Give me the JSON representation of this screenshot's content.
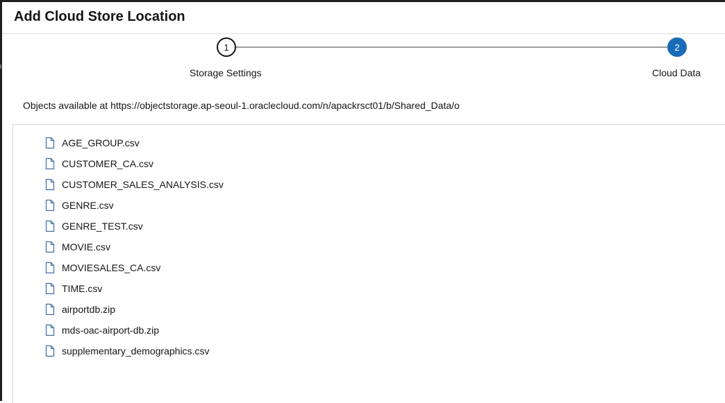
{
  "dialog": {
    "title": "Add Cloud Store Location"
  },
  "train": {
    "steps": [
      {
        "number": "1",
        "label": "Storage Settings",
        "state": "visited"
      },
      {
        "number": "2",
        "label": "Cloud Data",
        "state": "current"
      }
    ]
  },
  "objects_caption": "Objects available at https://objectstorage.ap-seoul-1.oraclecloud.com/n/apackrsct01/b/Shared_Data/o",
  "files": [
    {
      "name": "AGE_GROUP.csv",
      "icon": "file-icon"
    },
    {
      "name": "CUSTOMER_CA.csv",
      "icon": "file-icon"
    },
    {
      "name": "CUSTOMER_SALES_ANALYSIS.csv",
      "icon": "file-icon"
    },
    {
      "name": "GENRE.csv",
      "icon": "file-icon"
    },
    {
      "name": "GENRE_TEST.csv",
      "icon": "file-icon"
    },
    {
      "name": "MOVIE.csv",
      "icon": "file-icon"
    },
    {
      "name": "MOVIESALES_CA.csv",
      "icon": "file-icon"
    },
    {
      "name": "TIME.csv",
      "icon": "file-icon"
    },
    {
      "name": "airportdb.zip",
      "icon": "file-icon"
    },
    {
      "name": "mds-oac-airport-db.zip",
      "icon": "file-icon"
    },
    {
      "name": "supplementary_demographics.csv",
      "icon": "file-icon"
    }
  ],
  "colors": {
    "accent": "#1a6cb8",
    "text": "#161513",
    "icon": "#3a6ea5"
  }
}
